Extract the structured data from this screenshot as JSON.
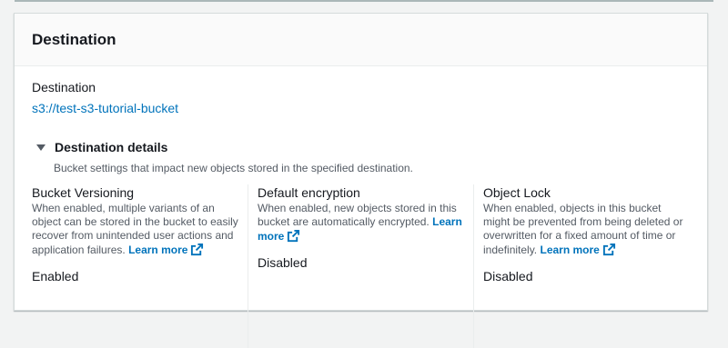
{
  "panel": {
    "title": "Destination",
    "destination_label": "Destination",
    "destination_value": "s3://test-s3-tutorial-bucket",
    "details": {
      "title": "Destination details",
      "description": "Bucket settings that impact new objects stored in the specified destination."
    }
  },
  "columns": [
    {
      "title": "Bucket Versioning",
      "description": "When enabled, multiple variants of an object can be stored in the bucket to easily recover from unintended user actions and application failures.",
      "learn_more": "Learn more",
      "value": "Enabled"
    },
    {
      "title": "Default encryption",
      "description": "When enabled, new objects stored in this bucket are automatically encrypted.",
      "learn_more": "Learn more",
      "value": "Disabled"
    },
    {
      "title": "Object Lock",
      "description": "When enabled, objects in this bucket might be prevented from being deleted or overwritten for a fixed amount of time or indefinitely.",
      "learn_more": "Learn more",
      "value": "Disabled"
    }
  ],
  "colors": {
    "link": "#0073bb",
    "text": "#16191f",
    "secondary_text": "#545b64"
  },
  "icons": {
    "caret": "caret-down-icon",
    "external": "external-link-icon"
  }
}
